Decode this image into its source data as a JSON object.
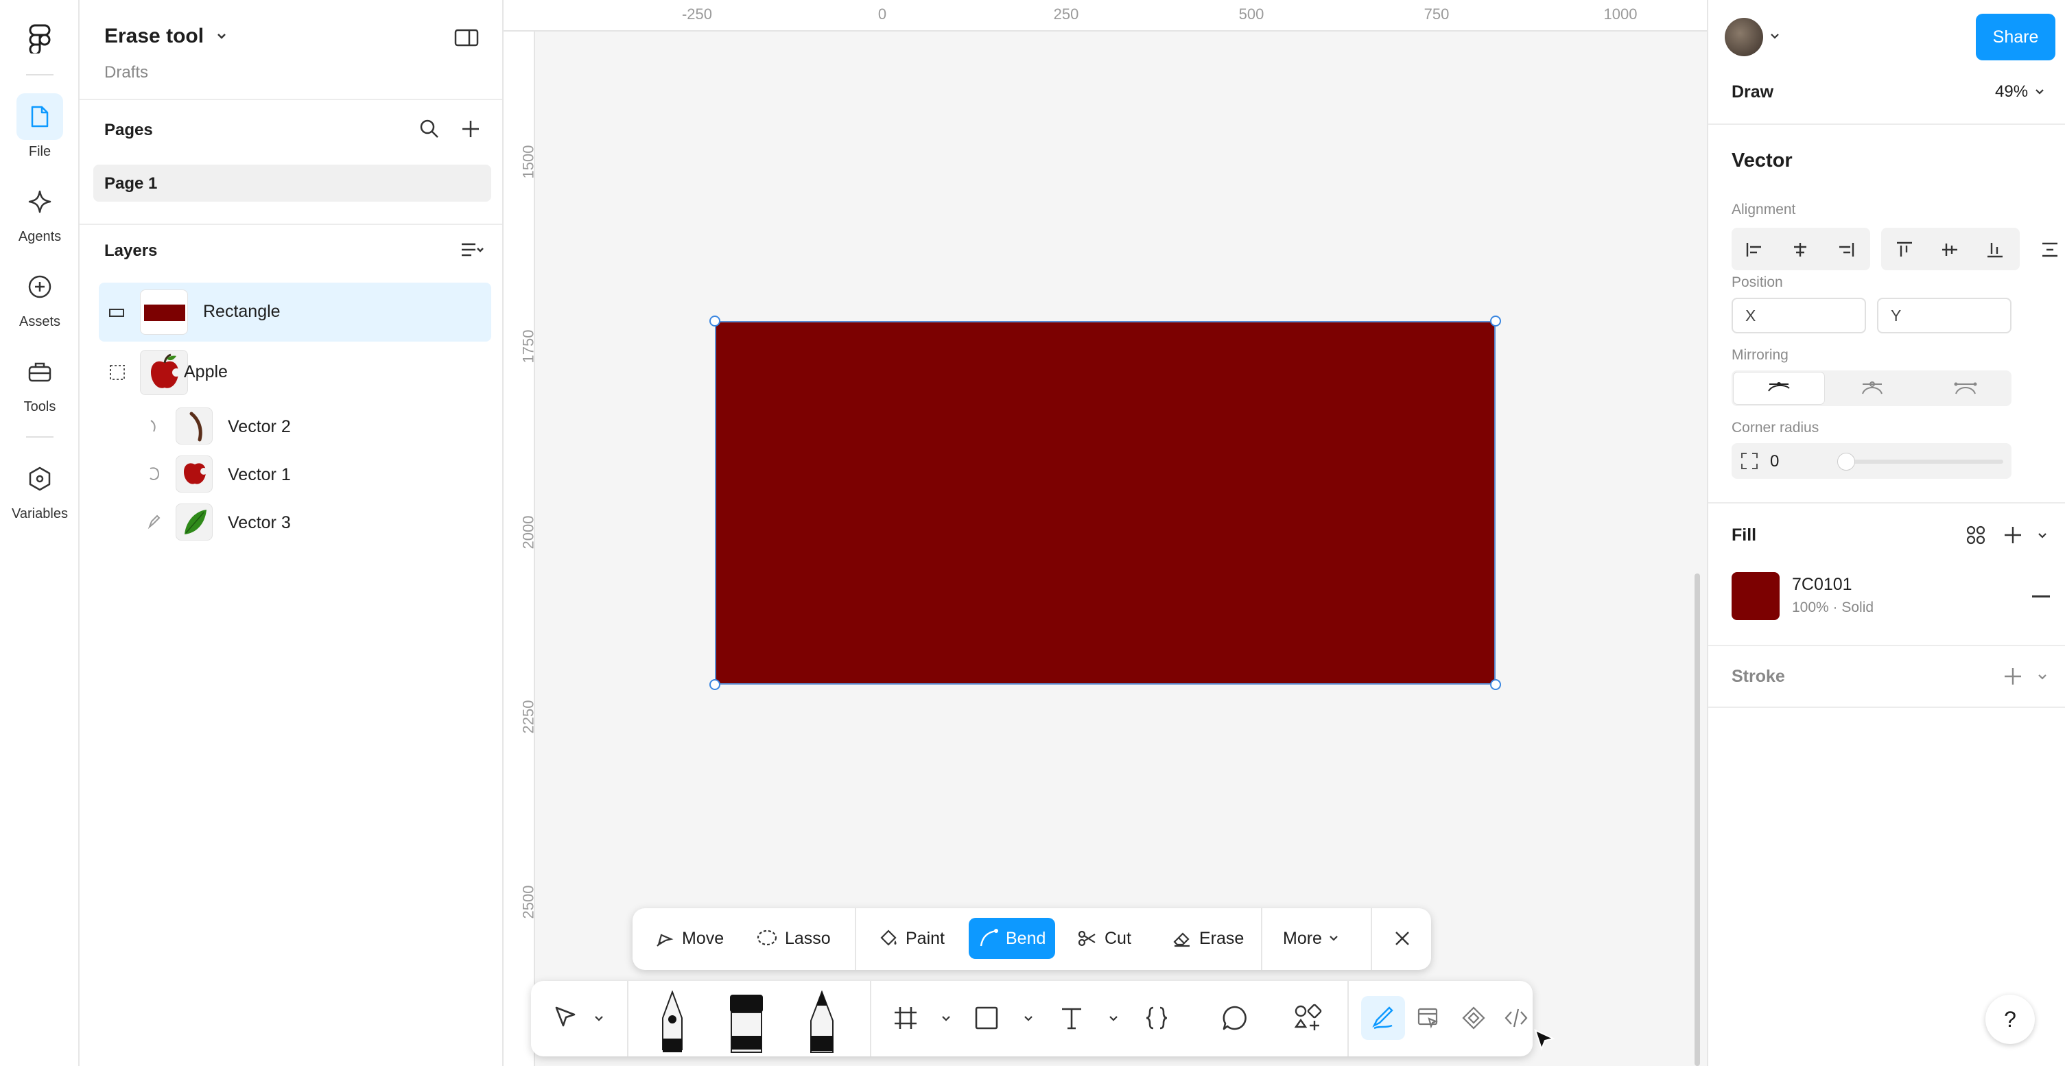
{
  "rail": {
    "items": [
      {
        "label": "File"
      },
      {
        "label": "Agents"
      },
      {
        "label": "Assets"
      },
      {
        "label": "Tools"
      },
      {
        "label": "Variables"
      }
    ]
  },
  "file": {
    "name": "Erase tool",
    "location": "Drafts"
  },
  "pages": {
    "title": "Pages",
    "items": [
      "Page 1"
    ]
  },
  "layers": {
    "title": "Layers",
    "items": [
      {
        "name": "Rectangle",
        "selected": true
      },
      {
        "name": "Apple"
      },
      {
        "name": "Vector 2"
      },
      {
        "name": "Vector 1"
      },
      {
        "name": "Vector 3"
      }
    ]
  },
  "rulers": {
    "x": [
      "-250",
      "0",
      "250",
      "500",
      "750",
      "1000"
    ],
    "y": [
      "1500",
      "1750",
      "2000",
      "2250",
      "2500"
    ]
  },
  "canvas": {
    "rect_color": "#7C0101"
  },
  "vector_toolbar": {
    "move": "Move",
    "lasso": "Lasso",
    "paint": "Paint",
    "bend": "Bend",
    "cut": "Cut",
    "erase": "Erase",
    "more": "More",
    "active": "Bend"
  },
  "header_right": {
    "share": "Share",
    "mode": "Draw",
    "zoom": "49%"
  },
  "properties": {
    "title": "Vector",
    "alignment_label": "Alignment",
    "position_label": "Position",
    "x_placeholder": "X",
    "y_placeholder": "Y",
    "mirroring_label": "Mirroring",
    "corner_radius_label": "Corner radius",
    "corner_radius_value": "0",
    "fill_title": "Fill",
    "fill_hex": "7C0101",
    "fill_meta": "100% · Solid",
    "fill_color": "#7C0101",
    "stroke_title": "Stroke"
  },
  "help": "?"
}
